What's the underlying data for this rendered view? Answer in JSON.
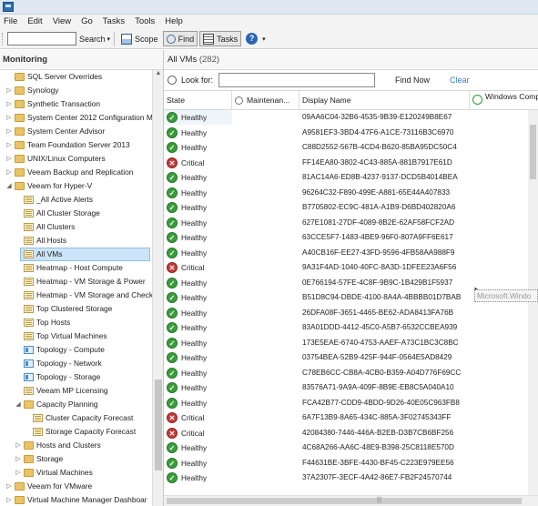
{
  "menu": [
    "File",
    "Edit",
    "View",
    "Go",
    "Tasks",
    "Tools",
    "Help"
  ],
  "toolbar": {
    "search_label": "Search",
    "scope_label": "Scope",
    "find_label": "Find",
    "tasks_label": "Tasks"
  },
  "left": {
    "header": "Monitoring",
    "tree": [
      {
        "label": "SQL Server Overrides",
        "icon": "folder",
        "level": 0,
        "arrow": ""
      },
      {
        "label": "Synology",
        "icon": "folder",
        "level": 0,
        "arrow": "▷"
      },
      {
        "label": "Synthetic Transaction",
        "icon": "folder",
        "level": 0,
        "arrow": "▷"
      },
      {
        "label": "System Center 2012 Configuration M",
        "icon": "folder",
        "level": 0,
        "arrow": "▷"
      },
      {
        "label": "System Center Advisor",
        "icon": "folder",
        "level": 0,
        "arrow": "▷"
      },
      {
        "label": "Team Foundation Server 2013",
        "icon": "folder",
        "level": 0,
        "arrow": "▷"
      },
      {
        "label": "UNIX/Linux Computers",
        "icon": "folder",
        "level": 0,
        "arrow": "▷"
      },
      {
        "label": "Veeam Backup and Replication",
        "icon": "folder",
        "level": 0,
        "arrow": "▷"
      },
      {
        "label": "Veeam for Hyper-V",
        "icon": "folder",
        "level": 0,
        "arrow": "◢"
      },
      {
        "label": "_All Active Alerts",
        "icon": "view",
        "level": 1,
        "arrow": ""
      },
      {
        "label": "All Cluster Storage",
        "icon": "view",
        "level": 1,
        "arrow": ""
      },
      {
        "label": "All Clusters",
        "icon": "view",
        "level": 1,
        "arrow": ""
      },
      {
        "label": "All Hosts",
        "icon": "view",
        "level": 1,
        "arrow": ""
      },
      {
        "label": "All VMs",
        "icon": "view",
        "level": 1,
        "arrow": "",
        "selected": true
      },
      {
        "label": "Heatmap - Host Compute",
        "icon": "view",
        "level": 1,
        "arrow": ""
      },
      {
        "label": "Heatmap - VM Storage & Power",
        "icon": "view",
        "level": 1,
        "arrow": ""
      },
      {
        "label": "Heatmap - VM Storage and Check",
        "icon": "view",
        "level": 1,
        "arrow": ""
      },
      {
        "label": "Top Clustered Storage",
        "icon": "view",
        "level": 1,
        "arrow": ""
      },
      {
        "label": "Top Hosts",
        "icon": "view",
        "level": 1,
        "arrow": ""
      },
      {
        "label": "Top Virtual Machines",
        "icon": "view",
        "level": 1,
        "arrow": ""
      },
      {
        "label": "Topology - Compute",
        "icon": "dash",
        "level": 1,
        "arrow": ""
      },
      {
        "label": "Topology - Network",
        "icon": "dash",
        "level": 1,
        "arrow": ""
      },
      {
        "label": "Topology - Storage",
        "icon": "dash",
        "level": 1,
        "arrow": ""
      },
      {
        "label": "Veeam MP Licensing",
        "icon": "view",
        "level": 1,
        "arrow": ""
      },
      {
        "label": "Capacity Planning",
        "icon": "folder",
        "level": 1,
        "arrow": "◢"
      },
      {
        "label": "Cluster Capacity Forecast",
        "icon": "view",
        "level": 2,
        "arrow": ""
      },
      {
        "label": "Storage Capacity Forecast",
        "icon": "view",
        "level": 2,
        "arrow": ""
      },
      {
        "label": "Hosts and Clusters",
        "icon": "folder",
        "level": 1,
        "arrow": "▷"
      },
      {
        "label": "Storage",
        "icon": "folder",
        "level": 1,
        "arrow": "▷"
      },
      {
        "label": "Virtual Machines",
        "icon": "folder",
        "level": 1,
        "arrow": "▷"
      },
      {
        "label": "Veeam for VMware",
        "icon": "folder",
        "level": 0,
        "arrow": "▷"
      },
      {
        "label": "Virtual Machine Manager Dashboar",
        "icon": "folder",
        "level": 0,
        "arrow": "▷"
      }
    ]
  },
  "view": {
    "title": "All VMs",
    "count": "(282)",
    "look_for_label": "Look for:",
    "find_now_label": "Find Now",
    "clear_label": "Clear",
    "columns": [
      "State",
      "Maintenan...",
      "Display Name",
      "Windows Computer"
    ],
    "tooltip": "Microsoft.Windo",
    "rows": [
      {
        "state": "Healthy",
        "name": "09AA6C04-32B6-4535-9B39-E120249B8E67"
      },
      {
        "state": "Healthy",
        "name": "A9581EF3-3BD4-47F6-A1CE-73116B3C6970"
      },
      {
        "state": "Healthy",
        "name": "C88D2552-567B-4CD4-B620-85BA95DC50C4"
      },
      {
        "state": "Critical",
        "name": "FF14EA80-3802-4C43-885A-881B7917E61D"
      },
      {
        "state": "Healthy",
        "name": "81AC14A6-ED8B-4237-9137-DCD5B4014BEA"
      },
      {
        "state": "Healthy",
        "name": "96264C32-F890-499E-A881-65E44A407833"
      },
      {
        "state": "Healthy",
        "name": "B7705802-EC9C-481A-A1B9-D6BD402820A6"
      },
      {
        "state": "Healthy",
        "name": "627E1081-27DF-4089-8B2E-62AF58FCF2AD"
      },
      {
        "state": "Healthy",
        "name": "63CCE5F7-1483-4BE9-96F0-807A9FF6E617"
      },
      {
        "state": "Healthy",
        "name": "A40CB16F-EE27-43FD-9596-4FB58AA988F9"
      },
      {
        "state": "Critical",
        "name": "9A31F4AD-1040-40FC-8A3D-1DFEE23A6F56"
      },
      {
        "state": "Healthy",
        "name": "0E766194-57FE-4C8F-9B9C-1B429B1F5937"
      },
      {
        "state": "Healthy",
        "name": "B51D8C94-DBDE-4100-8A4A-4BBBB01D7BAB"
      },
      {
        "state": "Healthy",
        "name": "26DFA08F-3651-4465-BE62-ADA8413FA76B"
      },
      {
        "state": "Healthy",
        "name": "83A01DDD-4412-45C0-A5B7-6532CCBEA939"
      },
      {
        "state": "Healthy",
        "name": "173E5EAE-6740-4753-AAEF-A73C1BC3C8BC"
      },
      {
        "state": "Healthy",
        "name": "03754BEA-52B9-425F-944F-0564E5AD8429"
      },
      {
        "state": "Healthy",
        "name": "C78EB6CC-CB8A-4CB0-B359-A04D776F69CC"
      },
      {
        "state": "Healthy",
        "name": "83576A71-9A9A-409F-8B9E-EB8C5A040A10"
      },
      {
        "state": "Healthy",
        "name": "FCA42B77-CDD9-4BDD-9D26-40E05C963FB8"
      },
      {
        "state": "Critical",
        "name": "6A7F13B9-8A65-434C-885A-3F02745343FF"
      },
      {
        "state": "Critical",
        "name": "42084380-7446-446A-B2EB-D3B7CB6BF256"
      },
      {
        "state": "Healthy",
        "name": "4C68A266-AA6C-48E9-B398-25C8118E570D"
      },
      {
        "state": "Healthy",
        "name": "F44631BE-3BFE-4430-BF45-C223E979EE56"
      },
      {
        "state": "Healthy",
        "name": "37A2307F-3ECF-4A42-86E7-FB2F24570744"
      }
    ]
  },
  "colors": {
    "healthy": "#3a9e3a",
    "critical": "#c53a3a",
    "selection": "#cce4f7",
    "link": "#3b7ccb"
  }
}
